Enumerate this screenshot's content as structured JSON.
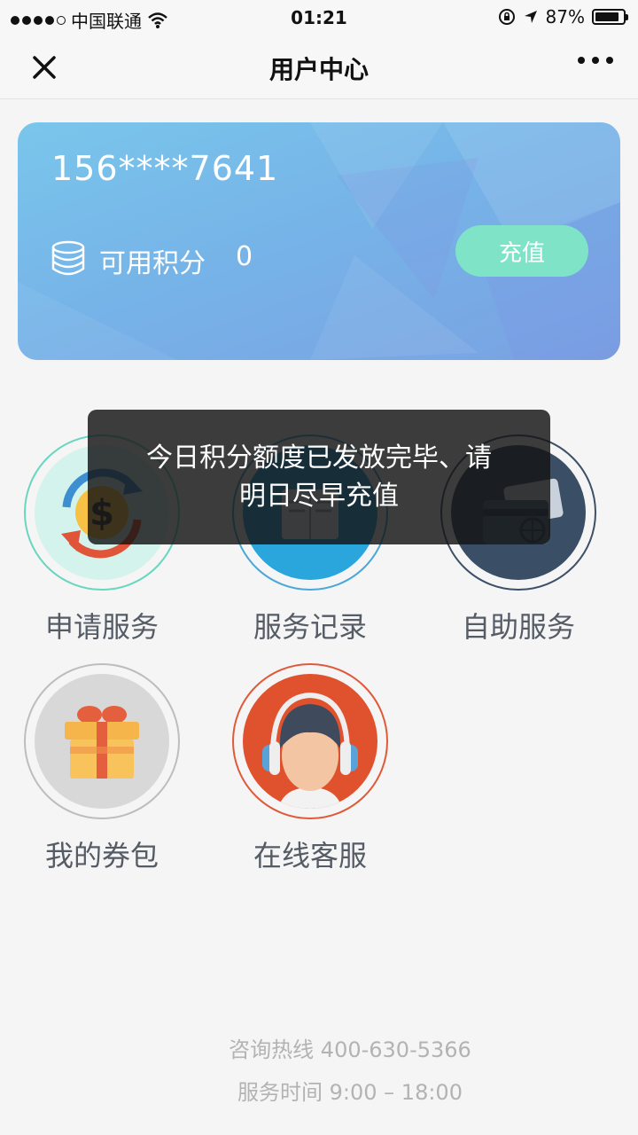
{
  "status_bar": {
    "carrier": "中国联通",
    "time": "01:21",
    "battery": "87%"
  },
  "nav": {
    "title": "用户中心",
    "close_icon": "close-icon",
    "more_icon": "more-icon"
  },
  "card": {
    "phone": "156****7641",
    "points_label": "可用积分",
    "points_value": "0",
    "recharge_label": "充值",
    "accent": "#7fe3c8"
  },
  "services": [
    {
      "label": "申请服务",
      "icon": "dollar-exchange-icon",
      "ring_color": "#6ad6c0"
    },
    {
      "label": "服务记录",
      "icon": "record-book-icon",
      "ring_color": "#4aa8d8"
    },
    {
      "label": "自助服务",
      "icon": "bank-card-icon",
      "ring_color": "#3d5068"
    },
    {
      "label": "我的券包",
      "icon": "gift-box-icon",
      "ring_color": "#bdbdbd"
    },
    {
      "label": "在线客服",
      "icon": "customer-service-icon",
      "ring_color": "#e05a3a"
    }
  ],
  "toast": {
    "line1": "今日积分额度已发放完毕、请",
    "line2": "明日尽早充值"
  },
  "footer": {
    "hotline": "咨询热线 400-630-5366",
    "hours": "服务时间 9:00 – 18:00"
  }
}
